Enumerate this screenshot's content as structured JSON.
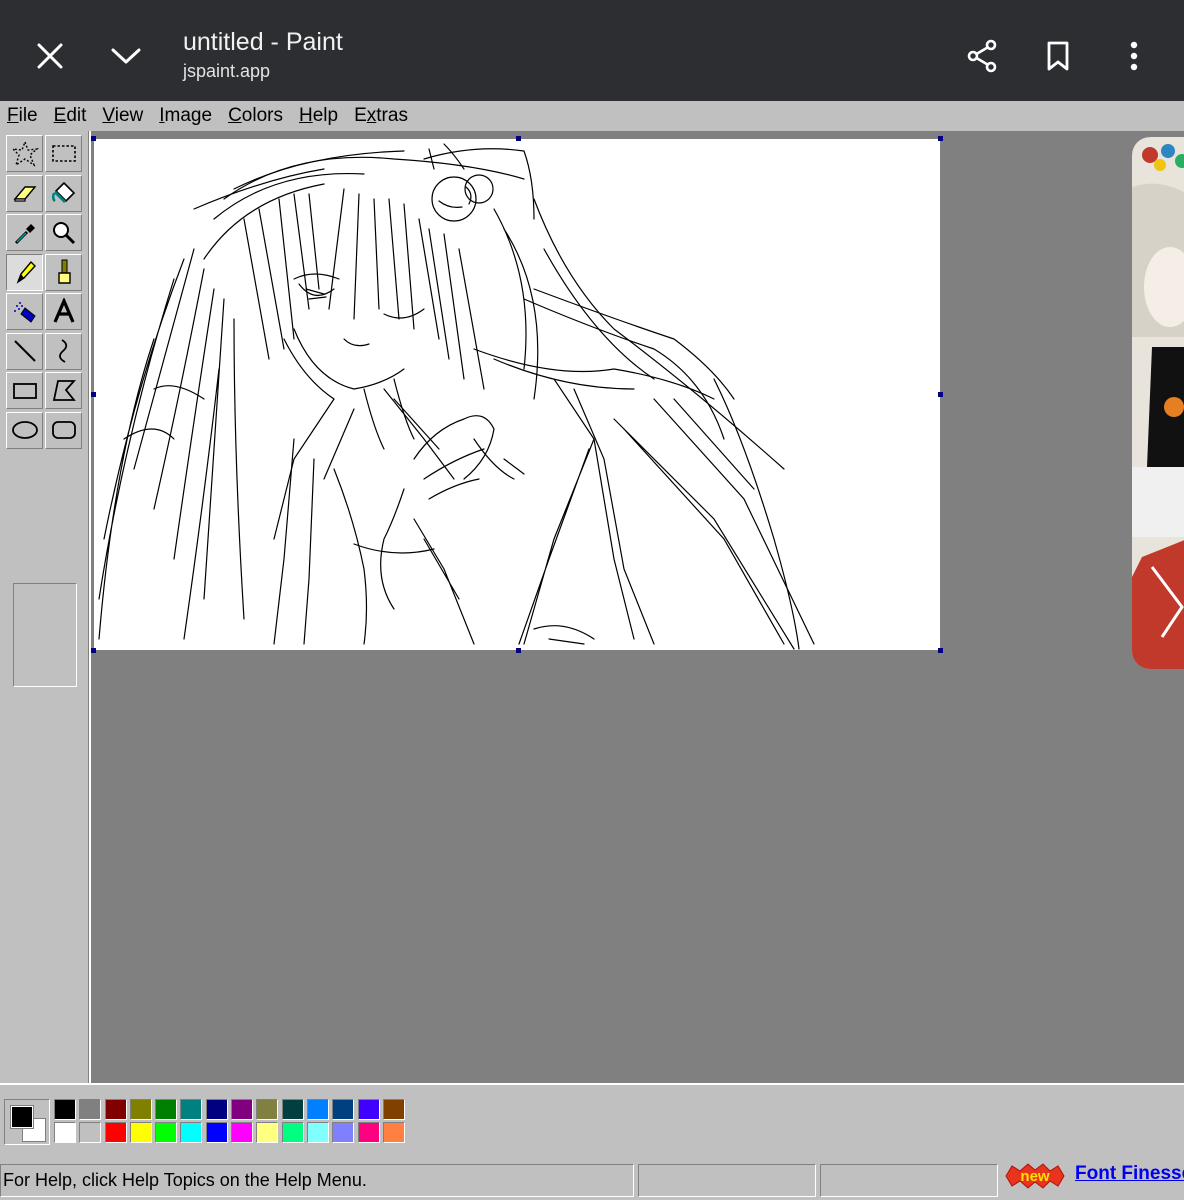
{
  "browser": {
    "title": "untitled - Paint",
    "url": "jspaint.app",
    "icons": [
      "close-icon",
      "chevron-down-icon",
      "share-icon",
      "bookmark-icon",
      "more-vert-icon"
    ]
  },
  "menu": [
    {
      "label": "File",
      "access": "F"
    },
    {
      "label": "Edit",
      "access": "E"
    },
    {
      "label": "View",
      "access": "V"
    },
    {
      "label": "Image",
      "access": "I"
    },
    {
      "label": "Colors",
      "access": "C"
    },
    {
      "label": "Help",
      "access": "H"
    },
    {
      "label": "Extras",
      "access": "x"
    }
  ],
  "tools": [
    {
      "name": "free-form-select",
      "icon": "free-form-select-icon"
    },
    {
      "name": "select",
      "icon": "rect-select-icon"
    },
    {
      "name": "eraser",
      "icon": "eraser-icon"
    },
    {
      "name": "fill-with-color",
      "icon": "paint-bucket-icon"
    },
    {
      "name": "pick-color",
      "icon": "eyedropper-icon"
    },
    {
      "name": "magnifier",
      "icon": "magnifier-icon"
    },
    {
      "name": "pencil",
      "icon": "pencil-icon",
      "selected": true
    },
    {
      "name": "brush",
      "icon": "brush-icon"
    },
    {
      "name": "airbrush",
      "icon": "airbrush-icon"
    },
    {
      "name": "text",
      "icon": "text-icon"
    },
    {
      "name": "line",
      "icon": "line-icon"
    },
    {
      "name": "curve",
      "icon": "curve-icon"
    },
    {
      "name": "rectangle",
      "icon": "rectangle-icon"
    },
    {
      "name": "polygon",
      "icon": "polygon-icon"
    },
    {
      "name": "ellipse",
      "icon": "ellipse-icon"
    },
    {
      "name": "rounded-rectangle",
      "icon": "rounded-rectangle-icon"
    }
  ],
  "colors": {
    "foreground": "#000000",
    "background": "#ffffff",
    "palette": [
      "#000000",
      "#808080",
      "#800000",
      "#808000",
      "#008000",
      "#008080",
      "#000080",
      "#800080",
      "#808040",
      "#004040",
      "#0080ff",
      "#004080",
      "#4000ff",
      "#804000",
      "#ffffff",
      "#c0c0c0",
      "#ff0000",
      "#ffff00",
      "#00ff00",
      "#00ffff",
      "#0000ff",
      "#ff00ff",
      "#ffff80",
      "#00ff80",
      "#80ffff",
      "#8080ff",
      "#ff0080",
      "#ff8040"
    ]
  },
  "status": {
    "help_text": "For Help, click Help Topics on the Help Menu.",
    "position": "",
    "size": ""
  },
  "ad": {
    "badge": "new",
    "link": "Font Finesse"
  },
  "canvas": {
    "content": "pencil line sketch drawing"
  }
}
